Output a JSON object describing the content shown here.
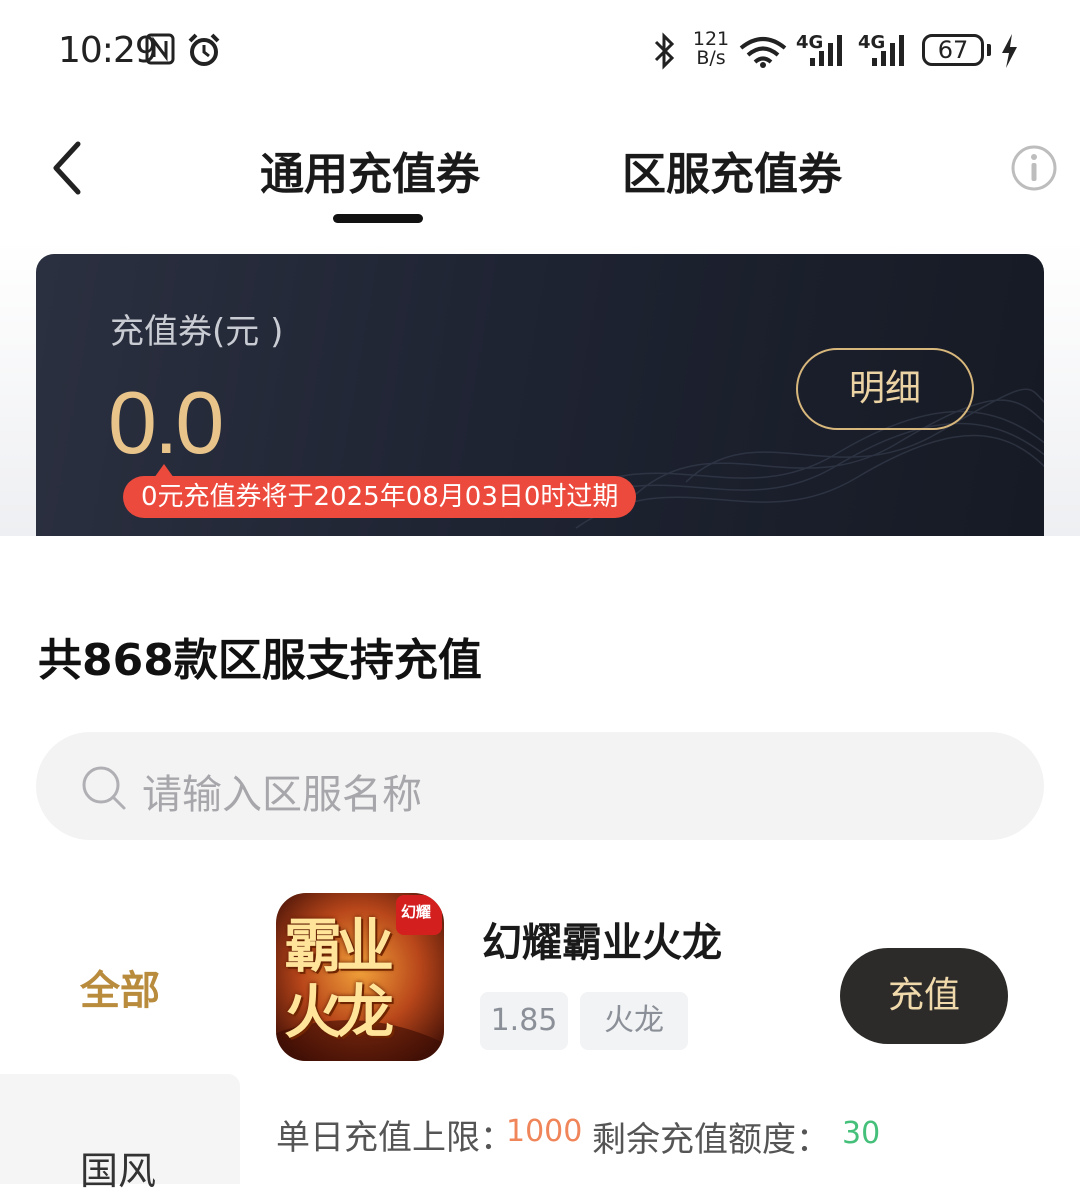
{
  "status_bar": {
    "time": "10:29",
    "net_speed_value": "121",
    "net_speed_unit": "B/s",
    "signal_1_label": "4G",
    "signal_2_label": "4G",
    "battery": "67",
    "icons": [
      "nfc-icon",
      "alarm-icon",
      "bluetooth-icon",
      "wifi-icon",
      "signal-icon",
      "battery-icon",
      "charging-icon"
    ]
  },
  "nav": {
    "tabs": [
      {
        "label": "通用充值券",
        "active": true
      },
      {
        "label": "区服充值券",
        "active": false
      }
    ],
    "icons": [
      "back-icon",
      "info-icon"
    ]
  },
  "voucher_card": {
    "label": "充值券(元 )",
    "amount": "0.0",
    "detail_button": "明细",
    "expire_notice": "0元充值券将于2025年08月03日0时过期"
  },
  "list_section": {
    "title": "共868款区服支持充值",
    "search_placeholder": "请输入区服名称"
  },
  "sidebar": {
    "items": [
      {
        "label": "全部",
        "active": true
      },
      {
        "label": "国风",
        "active": false
      }
    ]
  },
  "games": [
    {
      "name": "幻耀霸业火龙",
      "icon_text": "霸业火龙",
      "icon_badge": "幻耀",
      "tags": [
        "1.85",
        "火龙"
      ],
      "button": "充值",
      "daily_limit_label": "单日充值上限：",
      "daily_limit_value": "1000",
      "remaining_label": "剩余充值额度：",
      "remaining_value": "30"
    }
  ],
  "colors": {
    "accent_gold": "#e8c48a",
    "sidebar_active": "#b98b3d",
    "expire_red": "#ec4a3c",
    "limit_orange": "#f0855a",
    "remaining_green": "#45c07a",
    "card_dark": "#1f2433"
  }
}
